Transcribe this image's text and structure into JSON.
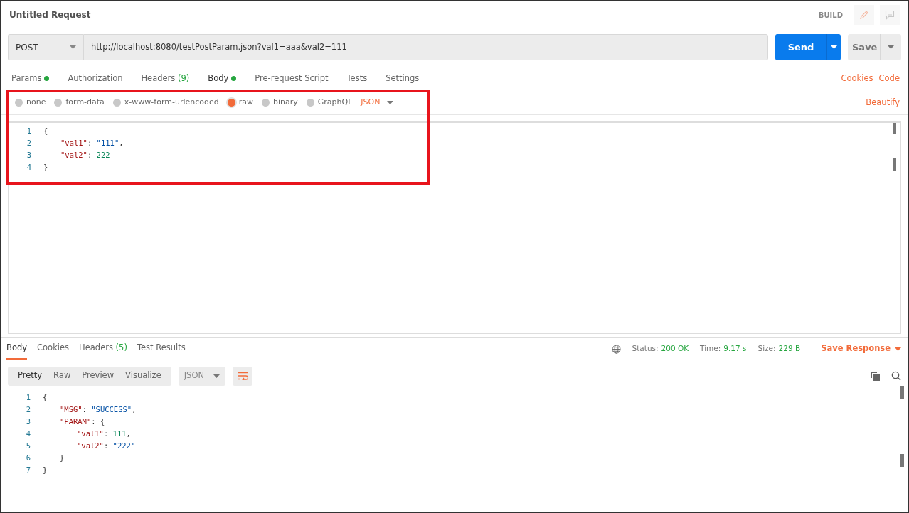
{
  "window": {
    "title": "Untitled Request",
    "mode": "BUILD"
  },
  "request": {
    "method": "POST",
    "url": "http://localhost:8080/testPostParam.json?val1=aaa&val2=111",
    "send": "Send",
    "save": "Save"
  },
  "tabs": [
    {
      "label": "Params",
      "dot": true,
      "selected": false
    },
    {
      "label": "Authorization",
      "dot": false,
      "selected": false
    },
    {
      "label": "Headers",
      "dot": false,
      "count": "(9)",
      "selected": false
    },
    {
      "label": "Body",
      "dot": true,
      "selected": true
    },
    {
      "label": "Pre-request Script",
      "dot": false,
      "selected": false
    },
    {
      "label": "Tests",
      "dot": false,
      "selected": false
    },
    {
      "label": "Settings",
      "dot": false,
      "selected": false
    }
  ],
  "tab_links": [
    "Cookies",
    "Code"
  ],
  "body_types": [
    {
      "label": "none",
      "selected": false
    },
    {
      "label": "form-data",
      "selected": false
    },
    {
      "label": "x-www-form-urlencoded",
      "selected": false
    },
    {
      "label": "raw",
      "selected": true
    },
    {
      "label": "binary",
      "selected": false
    },
    {
      "label": "GraphQL",
      "selected": false
    }
  ],
  "body_format": "JSON",
  "beautify": "Beautify",
  "request_body": [
    {
      "number": "1",
      "tokens": [
        {
          "text": "{",
          "kind": "punct"
        }
      ]
    },
    {
      "number": "2",
      "tokens": [
        {
          "text": "\"val1\"",
          "kind": "key"
        },
        {
          "text": ": ",
          "kind": "punct"
        },
        {
          "text": "\"111\"",
          "kind": "string"
        },
        {
          "text": ",",
          "kind": "punct"
        }
      ]
    },
    {
      "number": "3",
      "tokens": [
        {
          "text": "\"val2\"",
          "kind": "key"
        },
        {
          "text": ": ",
          "kind": "punct"
        },
        {
          "text": "222",
          "kind": "number"
        }
      ]
    },
    {
      "number": "4",
      "tokens": [
        {
          "text": "}",
          "kind": "punct"
        }
      ]
    }
  ],
  "response": {
    "tabs": [
      {
        "label": "Body",
        "selected": true
      },
      {
        "label": "Cookies",
        "selected": false
      },
      {
        "label": "Headers",
        "count": "(5)",
        "selected": false
      },
      {
        "label": "Test Results",
        "selected": false
      }
    ],
    "stats": [
      {
        "label": "Status:",
        "value": "200 OK"
      },
      {
        "label": "Time:",
        "value": "9.17 s"
      },
      {
        "label": "Size:",
        "value": "229 B"
      }
    ],
    "save_response": "Save Response",
    "views": [
      {
        "label": "Pretty",
        "selected": true
      },
      {
        "label": "Raw",
        "selected": false
      },
      {
        "label": "Preview",
        "selected": false
      },
      {
        "label": "Visualize",
        "selected": false
      }
    ],
    "format": "JSON",
    "lines": [
      {
        "number": "1",
        "tokens": [
          {
            "text": "{",
            "kind": "punct"
          }
        ]
      },
      {
        "number": "2",
        "tokens": [
          {
            "text": "\"MSG\"",
            "kind": "key"
          },
          {
            "text": ": ",
            "kind": "punct"
          },
          {
            "text": "\"SUCCESS\"",
            "kind": "string"
          },
          {
            "text": ",",
            "kind": "punct"
          }
        ]
      },
      {
        "number": "3",
        "tokens": [
          {
            "text": "\"PARAM\"",
            "kind": "key"
          },
          {
            "text": ": {",
            "kind": "punct"
          }
        ]
      },
      {
        "number": "4",
        "tokens": [
          {
            "text": "\"val1\"",
            "kind": "key"
          },
          {
            "text": ": ",
            "kind": "punct"
          },
          {
            "text": "111",
            "kind": "number"
          },
          {
            "text": ",",
            "kind": "punct"
          }
        ]
      },
      {
        "number": "5",
        "tokens": [
          {
            "text": "\"val2\"",
            "kind": "key"
          },
          {
            "text": ": ",
            "kind": "punct"
          },
          {
            "text": "\"222\"",
            "kind": "string"
          }
        ]
      },
      {
        "number": "6",
        "tokens": [
          {
            "text": "}",
            "kind": "punct"
          }
        ]
      },
      {
        "number": "7",
        "tokens": [
          {
            "text": "}",
            "kind": "punct"
          }
        ]
      }
    ]
  }
}
